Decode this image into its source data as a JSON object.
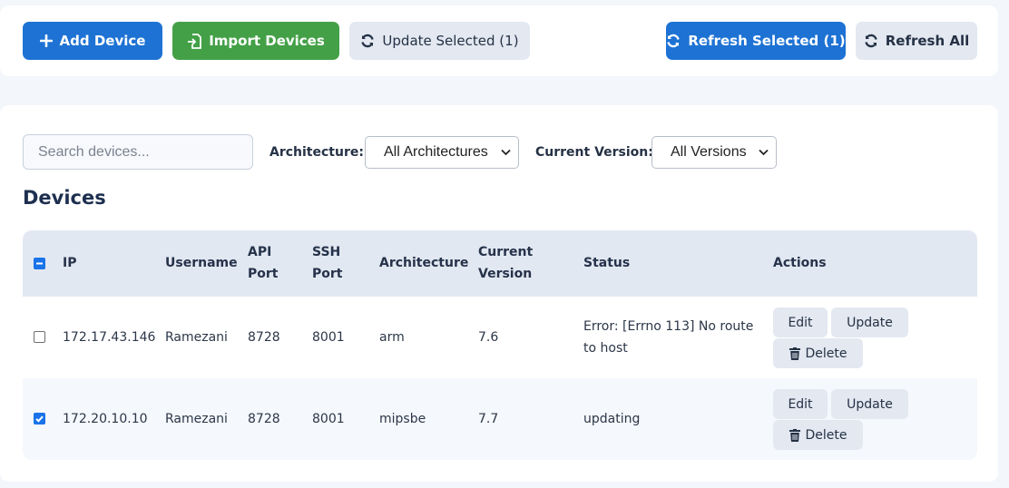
{
  "toolbar": {
    "add_device": "Add Device",
    "import_devices": "Import Devices",
    "update_selected": "Update Selected (1)",
    "refresh_selected": "Refresh Selected (1)",
    "refresh_all": "Refresh All"
  },
  "filters": {
    "search_placeholder": "Search devices...",
    "architecture_label": "Architecture:",
    "architecture_value": "All Architectures",
    "version_label": "Current Version:",
    "version_value": "All Versions"
  },
  "devices_title": "Devices",
  "table": {
    "headers": {
      "ip": "IP",
      "username": "Username",
      "api_port_1": "API",
      "api_port_2": "Port",
      "ssh_port_1": "SSH",
      "ssh_port_2": "Port",
      "architecture": "Architecture",
      "version_1": "Current",
      "version_2": "Version",
      "status": "Status",
      "actions": "Actions"
    },
    "rows": [
      {
        "selected": false,
        "ip": "172.17.43.146",
        "username": "Ramezani",
        "api_port": "8728",
        "ssh_port": "8001",
        "architecture": "arm",
        "version": "7.6",
        "status_1": "Error: [Errno 113] No route",
        "status_2": "to host"
      },
      {
        "selected": true,
        "ip": "172.20.10.10",
        "username": "Ramezani",
        "api_port": "8728",
        "ssh_port": "8001",
        "architecture": "mipsbe",
        "version": "7.7",
        "status_1": "updating",
        "status_2": ""
      }
    ],
    "actions": {
      "edit": "Edit",
      "update": "Update",
      "delete": "Delete"
    }
  },
  "colors": {
    "primary": "#1d72d4",
    "success": "#43a047",
    "secondary": "#e3e8f1",
    "checkbox": "#1a73e8"
  }
}
